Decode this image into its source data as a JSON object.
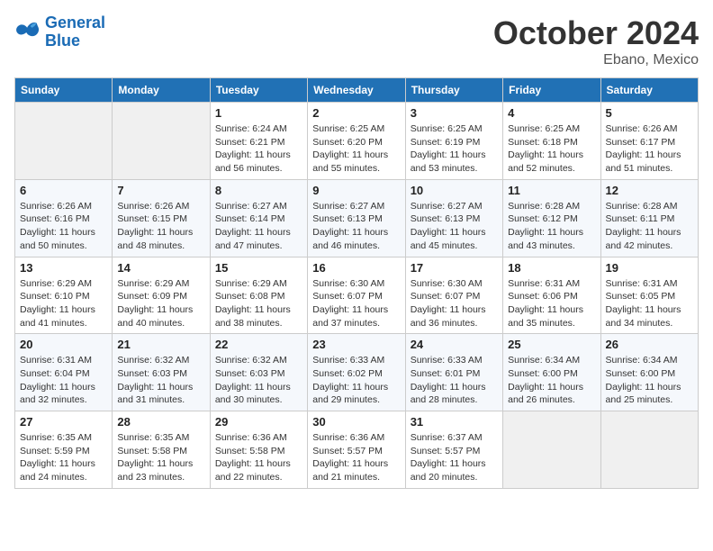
{
  "header": {
    "logo_line1": "General",
    "logo_line2": "Blue",
    "month": "October 2024",
    "location": "Ebano, Mexico"
  },
  "weekdays": [
    "Sunday",
    "Monday",
    "Tuesday",
    "Wednesday",
    "Thursday",
    "Friday",
    "Saturday"
  ],
  "weeks": [
    [
      {
        "day": "",
        "empty": true
      },
      {
        "day": "",
        "empty": true
      },
      {
        "day": "1",
        "sunrise": "6:24 AM",
        "sunset": "6:21 PM",
        "daylight": "11 hours and 56 minutes."
      },
      {
        "day": "2",
        "sunrise": "6:25 AM",
        "sunset": "6:20 PM",
        "daylight": "11 hours and 55 minutes."
      },
      {
        "day": "3",
        "sunrise": "6:25 AM",
        "sunset": "6:19 PM",
        "daylight": "11 hours and 53 minutes."
      },
      {
        "day": "4",
        "sunrise": "6:25 AM",
        "sunset": "6:18 PM",
        "daylight": "11 hours and 52 minutes."
      },
      {
        "day": "5",
        "sunrise": "6:26 AM",
        "sunset": "6:17 PM",
        "daylight": "11 hours and 51 minutes."
      }
    ],
    [
      {
        "day": "6",
        "sunrise": "6:26 AM",
        "sunset": "6:16 PM",
        "daylight": "11 hours and 50 minutes."
      },
      {
        "day": "7",
        "sunrise": "6:26 AM",
        "sunset": "6:15 PM",
        "daylight": "11 hours and 48 minutes."
      },
      {
        "day": "8",
        "sunrise": "6:27 AM",
        "sunset": "6:14 PM",
        "daylight": "11 hours and 47 minutes."
      },
      {
        "day": "9",
        "sunrise": "6:27 AM",
        "sunset": "6:13 PM",
        "daylight": "11 hours and 46 minutes."
      },
      {
        "day": "10",
        "sunrise": "6:27 AM",
        "sunset": "6:13 PM",
        "daylight": "11 hours and 45 minutes."
      },
      {
        "day": "11",
        "sunrise": "6:28 AM",
        "sunset": "6:12 PM",
        "daylight": "11 hours and 43 minutes."
      },
      {
        "day": "12",
        "sunrise": "6:28 AM",
        "sunset": "6:11 PM",
        "daylight": "11 hours and 42 minutes."
      }
    ],
    [
      {
        "day": "13",
        "sunrise": "6:29 AM",
        "sunset": "6:10 PM",
        "daylight": "11 hours and 41 minutes."
      },
      {
        "day": "14",
        "sunrise": "6:29 AM",
        "sunset": "6:09 PM",
        "daylight": "11 hours and 40 minutes."
      },
      {
        "day": "15",
        "sunrise": "6:29 AM",
        "sunset": "6:08 PM",
        "daylight": "11 hours and 38 minutes."
      },
      {
        "day": "16",
        "sunrise": "6:30 AM",
        "sunset": "6:07 PM",
        "daylight": "11 hours and 37 minutes."
      },
      {
        "day": "17",
        "sunrise": "6:30 AM",
        "sunset": "6:07 PM",
        "daylight": "11 hours and 36 minutes."
      },
      {
        "day": "18",
        "sunrise": "6:31 AM",
        "sunset": "6:06 PM",
        "daylight": "11 hours and 35 minutes."
      },
      {
        "day": "19",
        "sunrise": "6:31 AM",
        "sunset": "6:05 PM",
        "daylight": "11 hours and 34 minutes."
      }
    ],
    [
      {
        "day": "20",
        "sunrise": "6:31 AM",
        "sunset": "6:04 PM",
        "daylight": "11 hours and 32 minutes."
      },
      {
        "day": "21",
        "sunrise": "6:32 AM",
        "sunset": "6:03 PM",
        "daylight": "11 hours and 31 minutes."
      },
      {
        "day": "22",
        "sunrise": "6:32 AM",
        "sunset": "6:03 PM",
        "daylight": "11 hours and 30 minutes."
      },
      {
        "day": "23",
        "sunrise": "6:33 AM",
        "sunset": "6:02 PM",
        "daylight": "11 hours and 29 minutes."
      },
      {
        "day": "24",
        "sunrise": "6:33 AM",
        "sunset": "6:01 PM",
        "daylight": "11 hours and 28 minutes."
      },
      {
        "day": "25",
        "sunrise": "6:34 AM",
        "sunset": "6:00 PM",
        "daylight": "11 hours and 26 minutes."
      },
      {
        "day": "26",
        "sunrise": "6:34 AM",
        "sunset": "6:00 PM",
        "daylight": "11 hours and 25 minutes."
      }
    ],
    [
      {
        "day": "27",
        "sunrise": "6:35 AM",
        "sunset": "5:59 PM",
        "daylight": "11 hours and 24 minutes."
      },
      {
        "day": "28",
        "sunrise": "6:35 AM",
        "sunset": "5:58 PM",
        "daylight": "11 hours and 23 minutes."
      },
      {
        "day": "29",
        "sunrise": "6:36 AM",
        "sunset": "5:58 PM",
        "daylight": "11 hours and 22 minutes."
      },
      {
        "day": "30",
        "sunrise": "6:36 AM",
        "sunset": "5:57 PM",
        "daylight": "11 hours and 21 minutes."
      },
      {
        "day": "31",
        "sunrise": "6:37 AM",
        "sunset": "5:57 PM",
        "daylight": "11 hours and 20 minutes."
      },
      {
        "day": "",
        "empty": true
      },
      {
        "day": "",
        "empty": true
      }
    ]
  ],
  "labels": {
    "sunrise": "Sunrise:",
    "sunset": "Sunset:",
    "daylight": "Daylight:"
  }
}
